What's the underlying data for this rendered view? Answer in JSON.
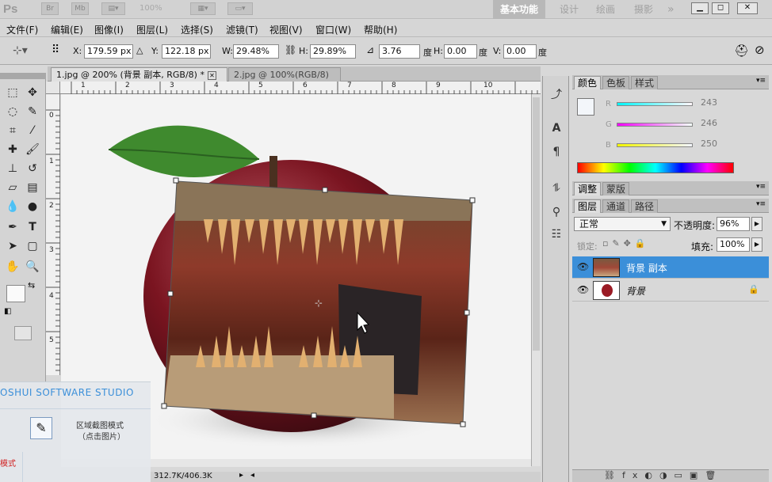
{
  "app": {
    "logo": "Ps",
    "zoom": "100%",
    "workspace": {
      "active": "基本功能",
      "others": [
        "设计",
        "绘画",
        "摄影"
      ]
    }
  },
  "menu": [
    "文件(F)",
    "编辑(E)",
    "图像(I)",
    "图层(L)",
    "选择(S)",
    "滤镜(T)",
    "视图(V)",
    "窗口(W)",
    "帮助(H)"
  ],
  "options": {
    "x_label": "X:",
    "x_value": "179.59 px",
    "y_label": "Y:",
    "y_value": "122.18 px",
    "w_label": "W:",
    "w_value": "29.48%",
    "h_label": "H:",
    "h_value": "29.89%",
    "angle_value": "3.76",
    "angle_unit": "度",
    "hskew_label": "H:",
    "hskew_value": "0.00",
    "hskew_unit": "度",
    "vskew_label": "V:",
    "vskew_value": "0.00",
    "vskew_unit": "度"
  },
  "tabs": [
    {
      "label": "1.jpg @ 200% (背景 副本, RGB/8) *"
    },
    {
      "label": "2.jpg @ 100%(RGB/8)"
    }
  ],
  "ruler": {
    "h_ticks": [
      "1",
      "2",
      "3",
      "4",
      "5",
      "6",
      "7",
      "8",
      "9",
      "10"
    ],
    "v_ticks": [
      "0",
      "1",
      "2",
      "3",
      "4",
      "5"
    ]
  },
  "status": {
    "doc_size": "312.7K/406.3K"
  },
  "color_panel": {
    "tabs": [
      "颜色",
      "色板",
      "样式"
    ],
    "r_label": "R",
    "g_label": "G",
    "b_label": "B",
    "r": "243",
    "g": "246",
    "b": "250"
  },
  "adjust_panel": {
    "tabs": [
      "调整",
      "蒙版"
    ]
  },
  "layers_panel": {
    "tabs": [
      "图层",
      "通道",
      "路径"
    ],
    "blend_mode": "正常",
    "opacity_label": "不透明度:",
    "opacity": "96%",
    "lock_label": "锁定:",
    "fill_label": "填充:",
    "fill": "100%",
    "layers": [
      {
        "name": "背景 副本",
        "selected": true
      },
      {
        "name": "背景",
        "selected": false
      }
    ]
  },
  "overlay": {
    "brand": "OSHUI SOFTWARE STUDIO",
    "mode_title": "区域截图模式",
    "mode_sub": "（点击图片）",
    "red_label": "模式"
  },
  "colors": {
    "accent": "#3b8fd9",
    "selected_layer": "#3b8fd9"
  }
}
